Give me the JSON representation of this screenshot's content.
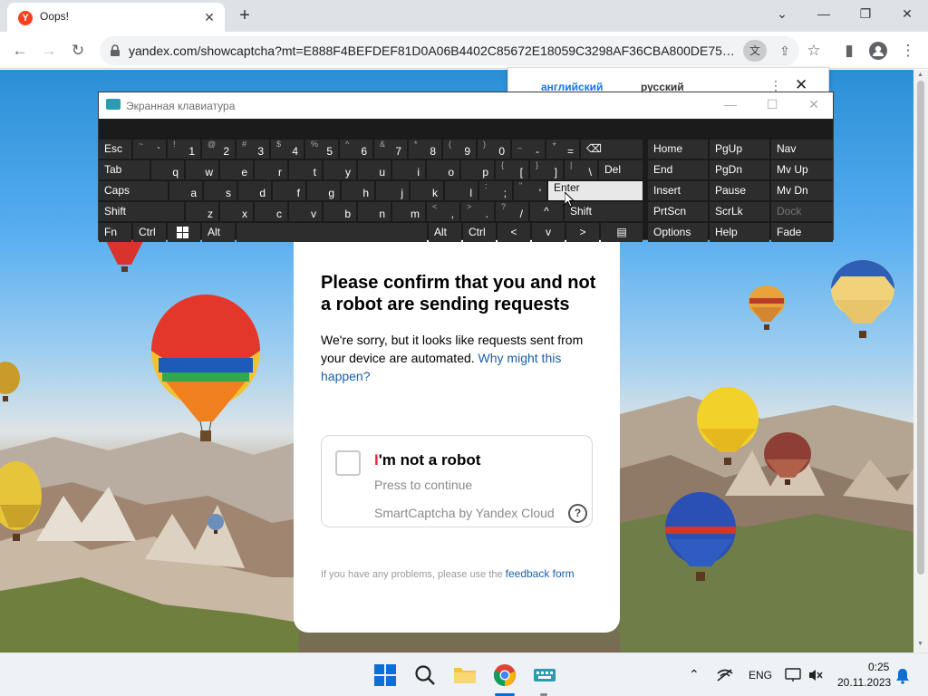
{
  "browser": {
    "tab_title": "Oops!",
    "tab_favicon_letter": "Y",
    "url": "yandex.com/showcaptcha?mt=E888F4BEFDEF81D0A06B4402C85672E18059C3298AF36CBA800DE755C59C..."
  },
  "translate_popup": {
    "source_lang": "английский",
    "target_lang": "русский"
  },
  "osk": {
    "title": "Экранная клавиатура",
    "keys": {
      "esc": "Esc",
      "tilde_sub": "~",
      "tilde": "`",
      "k1_sub": "!",
      "k1": "1",
      "k2_sub": "@",
      "k2": "2",
      "k3_sub": "#",
      "k3": "3",
      "k4_sub": "$",
      "k4": "4",
      "k5_sub": "%",
      "k5": "5",
      "k6_sub": "^",
      "k6": "6",
      "k7_sub": "&",
      "k7": "7",
      "k8_sub": "*",
      "k8": "8",
      "k9_sub": "(",
      "k9": "9",
      "k0_sub": ")",
      "k0": "0",
      "minus_sub": "_",
      "minus": "-",
      "equals_sub": "+",
      "equals": "=",
      "backspace": "⌫",
      "tab": "Tab",
      "q": "q",
      "w": "w",
      "e": "e",
      "r": "r",
      "t": "t",
      "y": "y",
      "u": "u",
      "i": "i",
      "o": "o",
      "p": "p",
      "lbracket_sub": "{",
      "lbracket": "[",
      "rbracket_sub": "}",
      "rbracket": "]",
      "backslash_sub": "|",
      "backslash": "\\",
      "del": "Del",
      "caps": "Caps",
      "a": "a",
      "s": "s",
      "d": "d",
      "f": "f",
      "g": "g",
      "h": "h",
      "j": "j",
      "k": "k",
      "l": "l",
      "semicolon_sub": ":",
      "semicolon": ";",
      "quote_sub": "\"",
      "quote": "'",
      "enter": "Enter",
      "shift": "Shift",
      "z": "z",
      "x": "x",
      "c": "c",
      "v": "v",
      "b": "b",
      "n": "n",
      "m": "m",
      "comma_sub": "<",
      "comma": ",",
      "period_sub": ">",
      "period": ".",
      "slash_sub": "?",
      "slash": "/",
      "up": "^",
      "shift_r": "Shift",
      "fn": "Fn",
      "ctrl": "Ctrl",
      "alt": "Alt",
      "alt_r": "Alt",
      "ctrl_r": "Ctrl",
      "left": "<",
      "down": "v",
      "right": ">",
      "home": "Home",
      "pgup": "PgUp",
      "nav": "Nav",
      "end": "End",
      "pgdn": "PgDn",
      "mvup": "Mv Up",
      "insert": "Insert",
      "pause": "Pause",
      "mvdn": "Mv Dn",
      "prtscn": "PrtScn",
      "scrlk": "ScrLk",
      "dock": "Dock",
      "options": "Options",
      "help": "Help",
      "fade": "Fade"
    }
  },
  "captcha": {
    "heading": "Please confirm that you and not a robot are sending requests",
    "description": "We're sorry, but it looks like requests sent from your device are automated.",
    "why_link": "Why might this happen?",
    "checkbox_label_first": "I",
    "checkbox_label_rest": "'m not a robot",
    "press_to_continue": "Press to continue",
    "provider": "SmartCaptcha by Yandex Cloud",
    "help_symbol": "?",
    "footer_text": "If you have any problems, please use the",
    "footer_link": "feedback form"
  },
  "taskbar": {
    "language": "ENG",
    "time": "0:25",
    "date": "20.11.2023"
  },
  "colors": {
    "brand_red": "#fc3f1d",
    "link_blue": "#1a5eaa",
    "robot_red": "#e8263f"
  }
}
